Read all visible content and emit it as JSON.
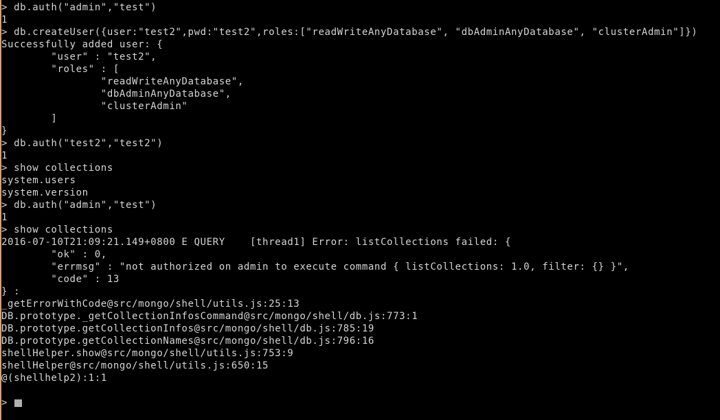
{
  "terminal": {
    "app": "mongo-shell",
    "background_color": "#000000",
    "text_color": "#d6d6d6",
    "border_color": "#c9a288",
    "cursor_color": "#b0b0b0",
    "prompt_symbol": ">",
    "cursor_glyph": "block-cursor",
    "lines": [
      "> db.auth(\"admin\",\"test\")",
      "1",
      "> db.createUser({user:\"test2\",pwd:\"test2\",roles:[\"readWriteAnyDatabase\", \"dbAdminAnyDatabase\", \"clusterAdmin\"]})",
      "Successfully added user: {",
      "        \"user\" : \"test2\",",
      "        \"roles\" : [",
      "                \"readWriteAnyDatabase\",",
      "                \"dbAdminAnyDatabase\",",
      "                \"clusterAdmin\"",
      "        ]",
      "}",
      "> db.auth(\"test2\",\"test2\")",
      "1",
      "> show collections",
      "system.users",
      "system.version",
      "> db.auth(\"admin\",\"test\")",
      "1",
      "> show collections",
      "2016-07-10T21:09:21.149+0800 E QUERY    [thread1] Error: listCollections failed: {",
      "        \"ok\" : 0,",
      "        \"errmsg\" : \"not authorized on admin to execute command { listCollections: 1.0, filter: {} }\",",
      "        \"code\" : 13",
      "} :",
      "_getErrorWithCode@src/mongo/shell/utils.js:25:13",
      "DB.prototype._getCollectionInfosCommand@src/mongo/shell/db.js:773:1",
      "DB.prototype.getCollectionInfos@src/mongo/shell/db.js:785:19",
      "DB.prototype.getCollectionNames@src/mongo/shell/db.js:796:16",
      "shellHelper.show@src/mongo/shell/utils.js:753:9",
      "shellHelper@src/mongo/shell/utils.js:650:15",
      "@(shellhelp2):1:1",
      ""
    ]
  }
}
